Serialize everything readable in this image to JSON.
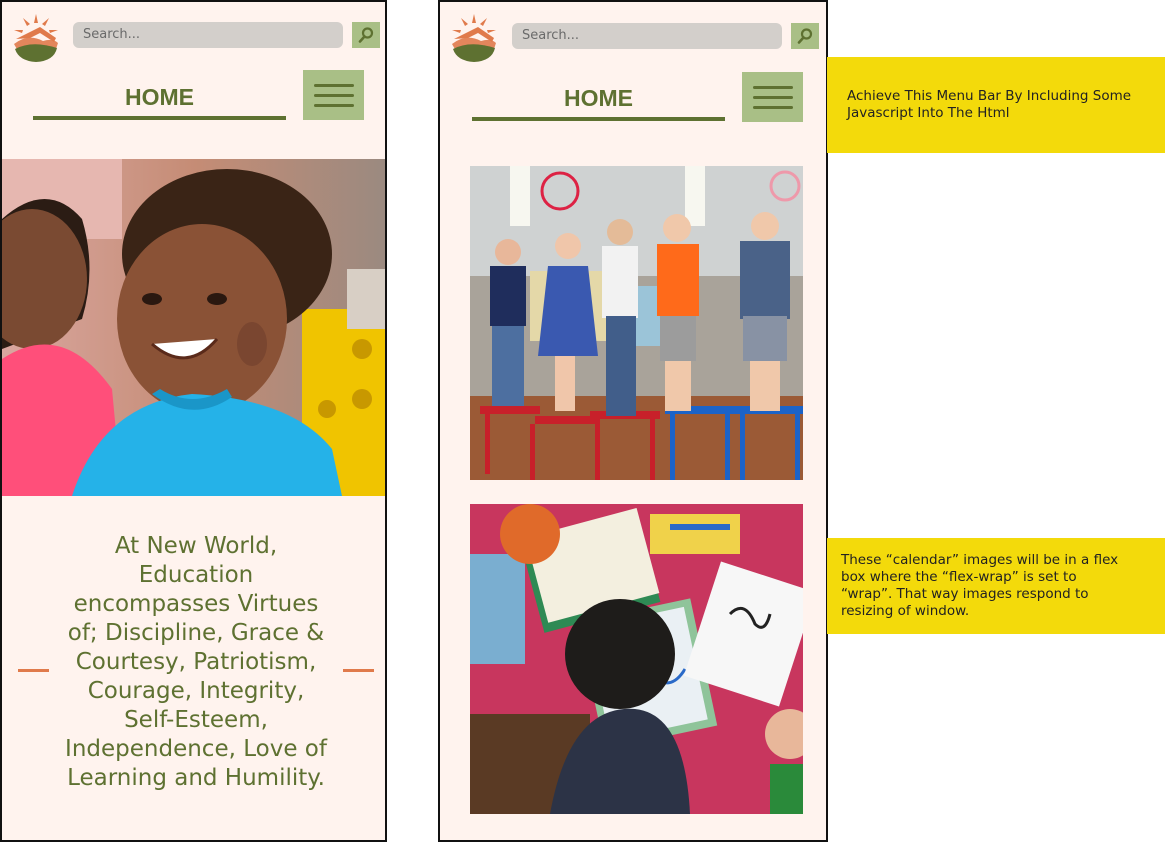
{
  "search": {
    "placeholder": "Search..."
  },
  "nav": {
    "home_label": "HOME"
  },
  "content": {
    "virtues_text": "At New World, Education encompasses Virtues of; Discipline, Grace & Courtesy, Patriotism, Courage, Integrity, Self-Esteem, Independence, Love of Learning and Humility."
  },
  "annotations": {
    "menu_note": "Achieve This Menu Bar By Including Some Javascript Into The Html",
    "flex_note": "These “calendar” images will  be in a flex\n box where the “flex-wrap” is set to\n“wrap”. That way images respond to\nresizing of window."
  },
  "colors": {
    "page_bg": "#fff3ee",
    "brand_green": "#5e7131",
    "button_green": "#a9bf86",
    "accent_orange": "#e07a4b",
    "note_yellow": "#f3da0b"
  },
  "icons": [
    "sun-hills-logo-icon",
    "search-magnifier-icon",
    "hamburger-menu-icon"
  ]
}
